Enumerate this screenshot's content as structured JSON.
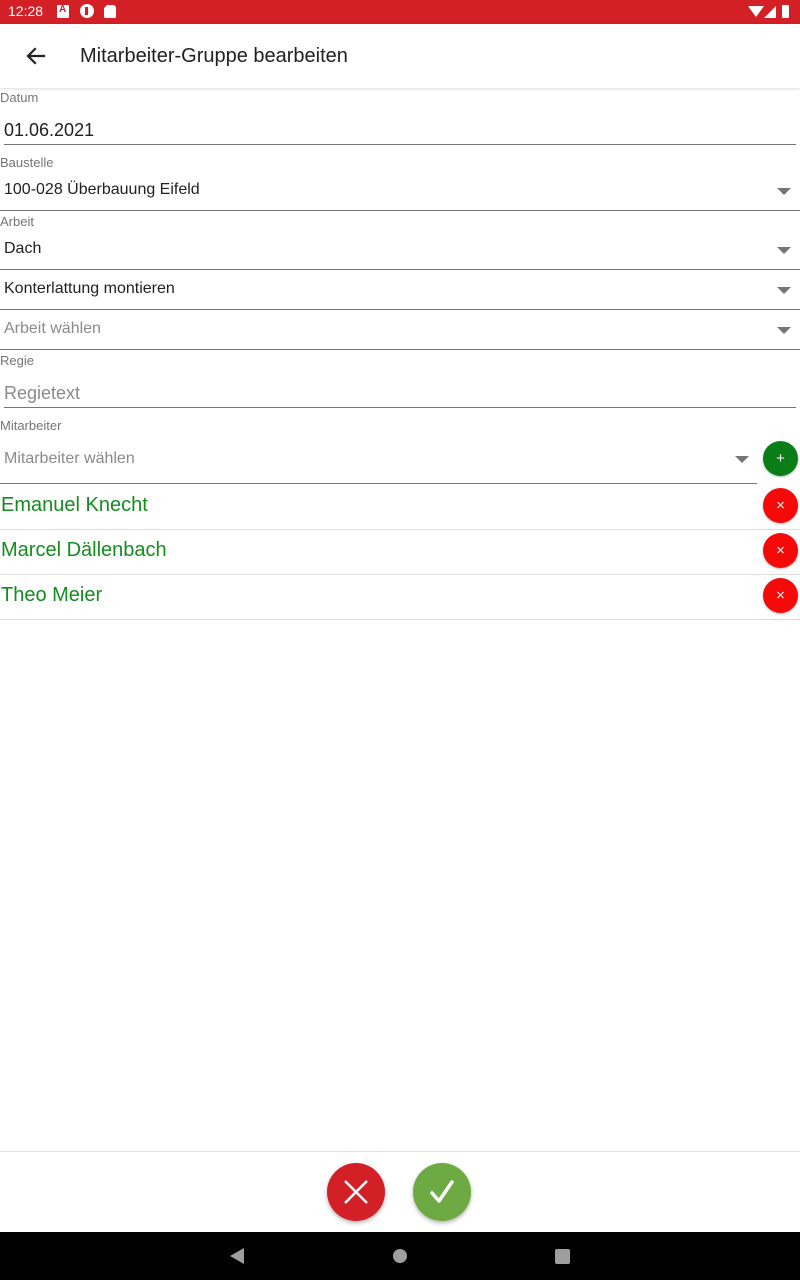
{
  "status_bar": {
    "time": "12:28",
    "left_icons": [
      "app-a-icon",
      "pocket-icon",
      "sd-card-icon"
    ],
    "right_icons": [
      "wifi-icon",
      "signal-icon",
      "battery-icon"
    ]
  },
  "app_bar": {
    "back_icon": "arrow-left-icon",
    "title": "Mitarbeiter-Gruppe bearbeiten"
  },
  "form": {
    "datum": {
      "label": "Datum",
      "value": "01.06.2021"
    },
    "baustelle": {
      "label": "Baustelle",
      "value": "100-028 Überbauung Eifeld"
    },
    "arbeit": {
      "label": "Arbeit",
      "level1": "Dach",
      "level2": "Konterlattung montieren",
      "level3_placeholder": "Arbeit wählen"
    },
    "regie": {
      "label": "Regie",
      "value": "",
      "placeholder": "Regietext"
    },
    "mitarbeiter": {
      "label": "Mitarbeiter",
      "placeholder": "Mitarbeiter wählen",
      "add_icon": "+",
      "remove_icon": "×",
      "employees": [
        {
          "name": "Emanuel Knecht"
        },
        {
          "name": "Marcel Dällenbach"
        },
        {
          "name": "Theo Meier"
        }
      ]
    }
  },
  "colors": {
    "status_bar": "#d32027",
    "employee_text": "#148c1e",
    "add_button": "#0a7d17",
    "remove_button": "#f50a0a",
    "cancel_button": "#d32027",
    "confirm_button": "#6eaa44"
  },
  "bottom_actions": {
    "cancel_icon": "close-icon",
    "confirm_icon": "check-icon"
  },
  "nav_bar": {
    "buttons": [
      "back",
      "home",
      "recents"
    ]
  }
}
